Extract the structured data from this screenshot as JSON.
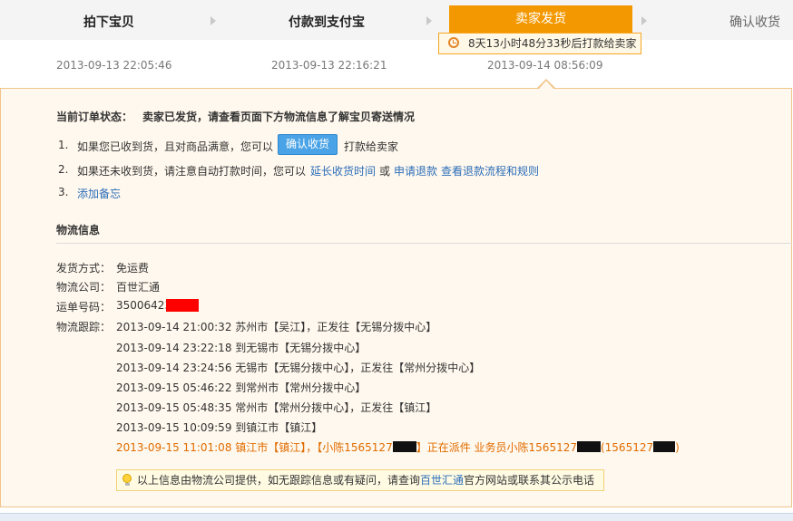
{
  "steps": [
    {
      "label": "拍下宝贝",
      "time": "2013-09-13 22:05:46"
    },
    {
      "label": "付款到支付宝",
      "time": "2013-09-13 22:16:21"
    },
    {
      "label": "卖家发货",
      "time": "2013-09-14 08:56:09"
    },
    {
      "label": "确认收货"
    }
  ],
  "countdown": "8天13小时48分33秒后打款给卖家",
  "status": {
    "label": "当前订单状态：",
    "text": "卖家已发货，请查看页面下方物流信息了解宝贝寄送情况"
  },
  "actions": {
    "item1": {
      "num": "1.",
      "prefix": "如果您已收到货，且对商品满意，您可以",
      "button": "确认收货",
      "suffix": "打款给卖家"
    },
    "item2": {
      "num": "2.",
      "prefix": "如果还未收到货，请注意自动打款时间，您可以",
      "link1": "延长收货时间",
      "or": "或",
      "link2": "申请退款",
      "link3": "查看退款流程和规则"
    },
    "item3": {
      "num": "3.",
      "link": "添加备忘"
    }
  },
  "logistics": {
    "title": "物流信息",
    "shipping_method_label": "发货方式：",
    "shipping_method": "免运费",
    "company_label": "物流公司：",
    "company": "百世汇通",
    "tracking_label": "运单号码：",
    "tracking_no": "35006423",
    "trace_label": "物流跟踪：",
    "traces": [
      "2013-09-14 21:00:32 苏州市【吴江】，正发往【无锡分拨中心】",
      "2013-09-14 23:22:18 到无锡市【无锡分拨中心】",
      "2013-09-14 23:24:56 无锡市【无锡分拨中心】，正发往【常州分拨中心】",
      "2013-09-15 05:46:22 到常州市【常州分拨中心】",
      "2013-09-15 05:48:35 常州市【常州分拨中心】，正发往【镇江】",
      "2013-09-15 10:09:59 到镇江市【镇江】"
    ],
    "last_trace": {
      "a": "2013-09-15 11:01:08 镇江市【镇江】，【小陈1565127",
      "b": "】正在派件 业务员小陈1565127",
      "c": "(1565127",
      "d": ")"
    },
    "notice_prefix": "以上信息由物流公司提供，如无跟踪信息或有疑问，请查询",
    "notice_link": "百世汇通",
    "notice_suffix": "官方网站或联系其公示电话"
  },
  "colors": {
    "accent": "#f39800",
    "link": "#2c6eb8",
    "highlight": "#e06c00",
    "button": "#4aa3e6"
  }
}
